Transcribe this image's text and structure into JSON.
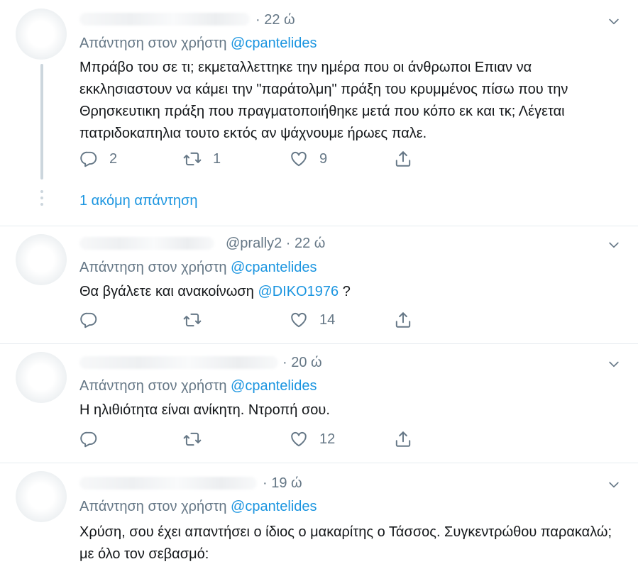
{
  "reply_prefix": "Απάντηση στον χρήστη",
  "tweets": [
    {
      "time": "· 22 ώ",
      "handle": "",
      "reply_to": "@cpantelides",
      "text": "Μπράβο του σε τι;  εκμεταλλεττηκε  την ημέρα που οι άνθρωποι Επιαν να εκκλησιαστουν να κάμει την \"παράτολμη\" πράξη του κρυμμένος πίσω που την Θρησκευτικη πράξη που πραγματοποιήθηκε μετά που κόπο εκ και τκ; Λέγεται πατριδοκαπηλια τουτο εκτός αν ψάχνουμε ήρωες παλε.",
      "replies": "2",
      "retweets": "1",
      "likes": "9",
      "more_replies": "1 ακόμη απάντηση"
    },
    {
      "time": "· 22 ώ",
      "handle": "@prally2",
      "reply_to": "@cpantelides",
      "text_before": "Θα βγάλετε και ανακοίνωση ",
      "mention": "@DIKO1976",
      "text_after": " ?",
      "replies": "",
      "retweets": "",
      "likes": "14"
    },
    {
      "time": "· 20 ώ",
      "handle": "",
      "reply_to": "@cpantelides",
      "text": "Η ηλιθιότητα είναι ανίκητη. Ντροπή σου.",
      "replies": "",
      "retweets": "",
      "likes": "12"
    },
    {
      "time": "· 19 ώ",
      "handle": "",
      "reply_to": "@cpantelides",
      "text": "Χρύση, σου έχει απαντήσει ο ίδιος ο μακαρίτης ο Τάσσος. Συγκεντρώθου παρακαλώ; με όλο τον σεβασμό:"
    }
  ],
  "colors": {
    "link": "#1b95e0",
    "muted": "#657786",
    "text": "#14171a",
    "divider": "#e6ecf0"
  },
  "icons": {
    "reply": "reply-icon",
    "retweet": "retweet-icon",
    "like": "heart-icon",
    "share": "share-icon",
    "menu": "chevron-down-icon"
  }
}
